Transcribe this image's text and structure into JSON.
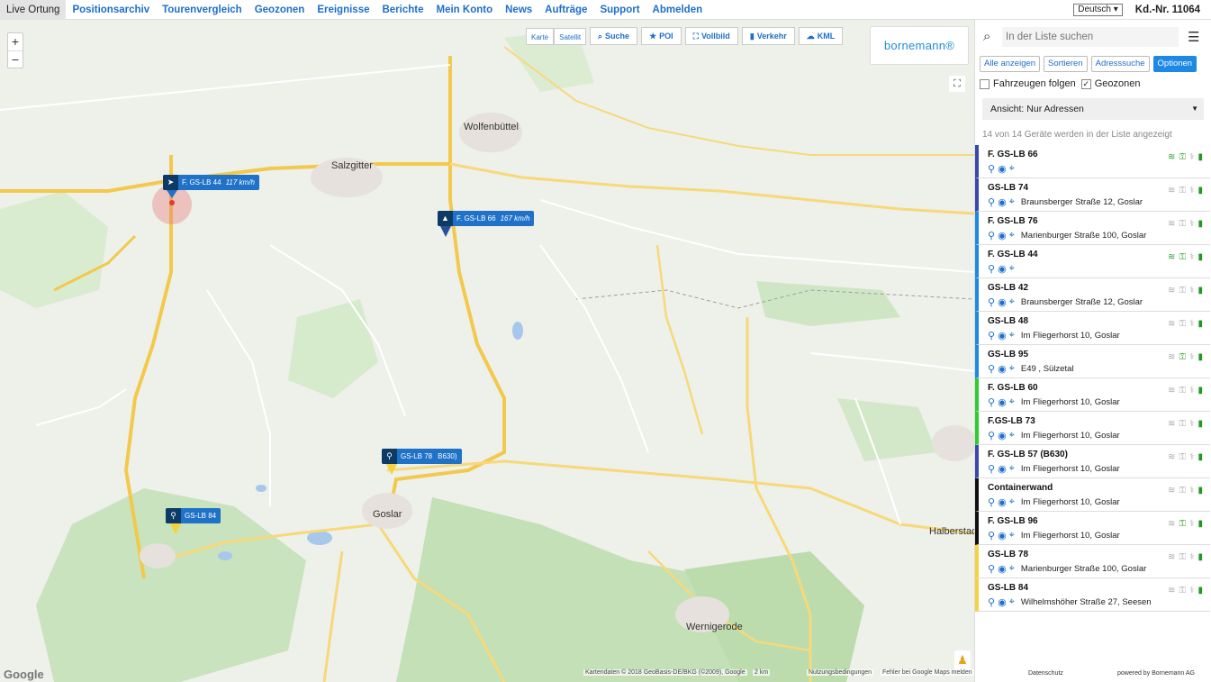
{
  "nav": {
    "items": [
      "Live Ortung",
      "Positionsarchiv",
      "Tourenvergleich",
      "Geozonen",
      "Ereignisse",
      "Berichte",
      "Mein Konto",
      "News",
      "Aufträge",
      "Support",
      "Abmelden"
    ],
    "language": "Deutsch",
    "customer": "Kd.-Nr. 11064"
  },
  "map": {
    "zoom_in": "+",
    "zoom_out": "−",
    "map_types": [
      "Karte",
      "Satellit"
    ],
    "buttons": {
      "search": "Suche",
      "poi": "POI",
      "fullscreen": "Vollbild",
      "traffic": "Verkehr",
      "kml": "KML"
    },
    "logo": "bornemann®",
    "google": "Google",
    "attribution": "Kartendaten © 2018 GeoBasis-DE/BKG (©2009), Google",
    "scale": "2 km",
    "terms": "Nutzungsbedingungen",
    "report": "Fehler bei Google Maps melden",
    "towns": [
      {
        "name": "Salzgitter",
        "big": true
      },
      {
        "name": "Wolfenbüttel",
        "big": true
      },
      {
        "name": "Goslar",
        "big": true
      },
      {
        "name": "Halberstadt",
        "big": true
      },
      {
        "name": "Wernigerode",
        "big": true
      }
    ],
    "markers": {
      "m1": {
        "label": "F. GS-LB 44",
        "speed": "117 km/h"
      },
      "m2": {
        "label": "F. GS-LB 66",
        "speed": "167 km/h"
      },
      "m3": {
        "label": "GS-LB 78",
        "extra": "B630)"
      },
      "m4": {
        "label": "GS-LB 84"
      }
    }
  },
  "sidebar": {
    "search_placeholder": "In der Liste suchen",
    "buttons": [
      "Alle anzeigen",
      "Sortieren",
      "Adresssuche",
      "Optionen"
    ],
    "follow_label": "Fahrzeugen folgen",
    "geozones_label": "Geozonen",
    "view": "Ansicht: Nur Adressen",
    "count_text": "14 von 14 Geräte werden in der Liste angezeigt",
    "colors": {
      "purple": "#3949ab",
      "blue": "#1e88e5",
      "green": "#2ecc2e",
      "black": "#111111",
      "yellow": "#f5d33c"
    },
    "vehicles": [
      {
        "name": "F. GS-LB 66",
        "address": ""
      },
      {
        "name": "GS-LB 74",
        "address": "Braunsberger Straße 12, Goslar"
      },
      {
        "name": "F. GS-LB 76",
        "address": "Marienburger Straße 100, Goslar"
      },
      {
        "name": "F. GS-LB 44",
        "address": ""
      },
      {
        "name": "GS-LB 42",
        "address": "Braunsberger Straße 12, Goslar"
      },
      {
        "name": "GS-LB 48",
        "address": "Im Fliegerhorst 10, Goslar"
      },
      {
        "name": "GS-LB 95",
        "address": "E49 , Sülzetal"
      },
      {
        "name": "F. GS-LB 60",
        "address": "Im Fliegerhorst 10, Goslar"
      },
      {
        "name": "F.GS-LB 73",
        "address": "Im Fliegerhorst 10, Goslar"
      },
      {
        "name": "F. GS-LB 57 (B630)",
        "address": "Im Fliegerhorst 10, Goslar"
      },
      {
        "name": "Containerwand",
        "address": "Im Fliegerhorst 10, Goslar"
      },
      {
        "name": "F. GS-LB 96",
        "address": "Im Fliegerhorst 10, Goslar"
      },
      {
        "name": "GS-LB 78",
        "address": "Marienburger Straße 100, Goslar"
      },
      {
        "name": "GS-LB 84",
        "address": "Wilhelmshöher Straße 27, Seesen"
      }
    ],
    "footer_privacy": "Datenschutz",
    "footer_powered": "powered by Bornemann AG"
  }
}
